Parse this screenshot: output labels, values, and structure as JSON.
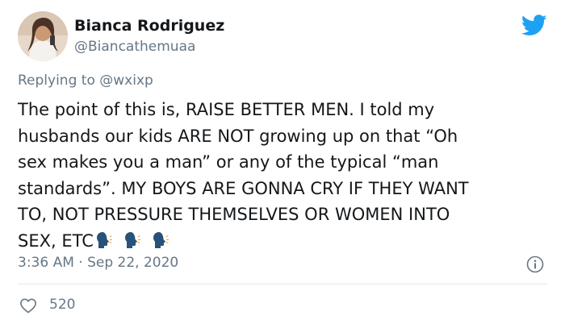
{
  "author": {
    "name": "Bianca Rodriguez",
    "handle": "@Biancathemuaa"
  },
  "reply": {
    "prefix": "Replying to ",
    "mention": "@wxixp"
  },
  "tweet": {
    "lines": [
      "The point of this is, RAISE BETTER MEN. I told my",
      "husbands our kids ARE NOT growing up on that “Oh",
      "sex makes you a man” or any of the typical “man",
      "standards”. MY BOYS ARE GONNA CRY IF THEY WANT",
      "TO, NOT PRESSURE THEMSELVES OR WOMEN INTO",
      "SEX, ETC"
    ],
    "emojis": [
      "speaking-head-emoji",
      "speaking-head-emoji",
      "speaking-head-emoji"
    ],
    "timestamp": "3:36 AM · Sep 22, 2020",
    "likes": "520"
  },
  "icons": {
    "brand": "twitter-bird-icon",
    "info": "info-icon",
    "like": "heart-outline-icon"
  },
  "colors": {
    "brand": "#1da1f2",
    "secondary_text": "#657786",
    "primary_text": "#14171a",
    "divider": "#e1e8ed",
    "emoji": "#28527a"
  }
}
